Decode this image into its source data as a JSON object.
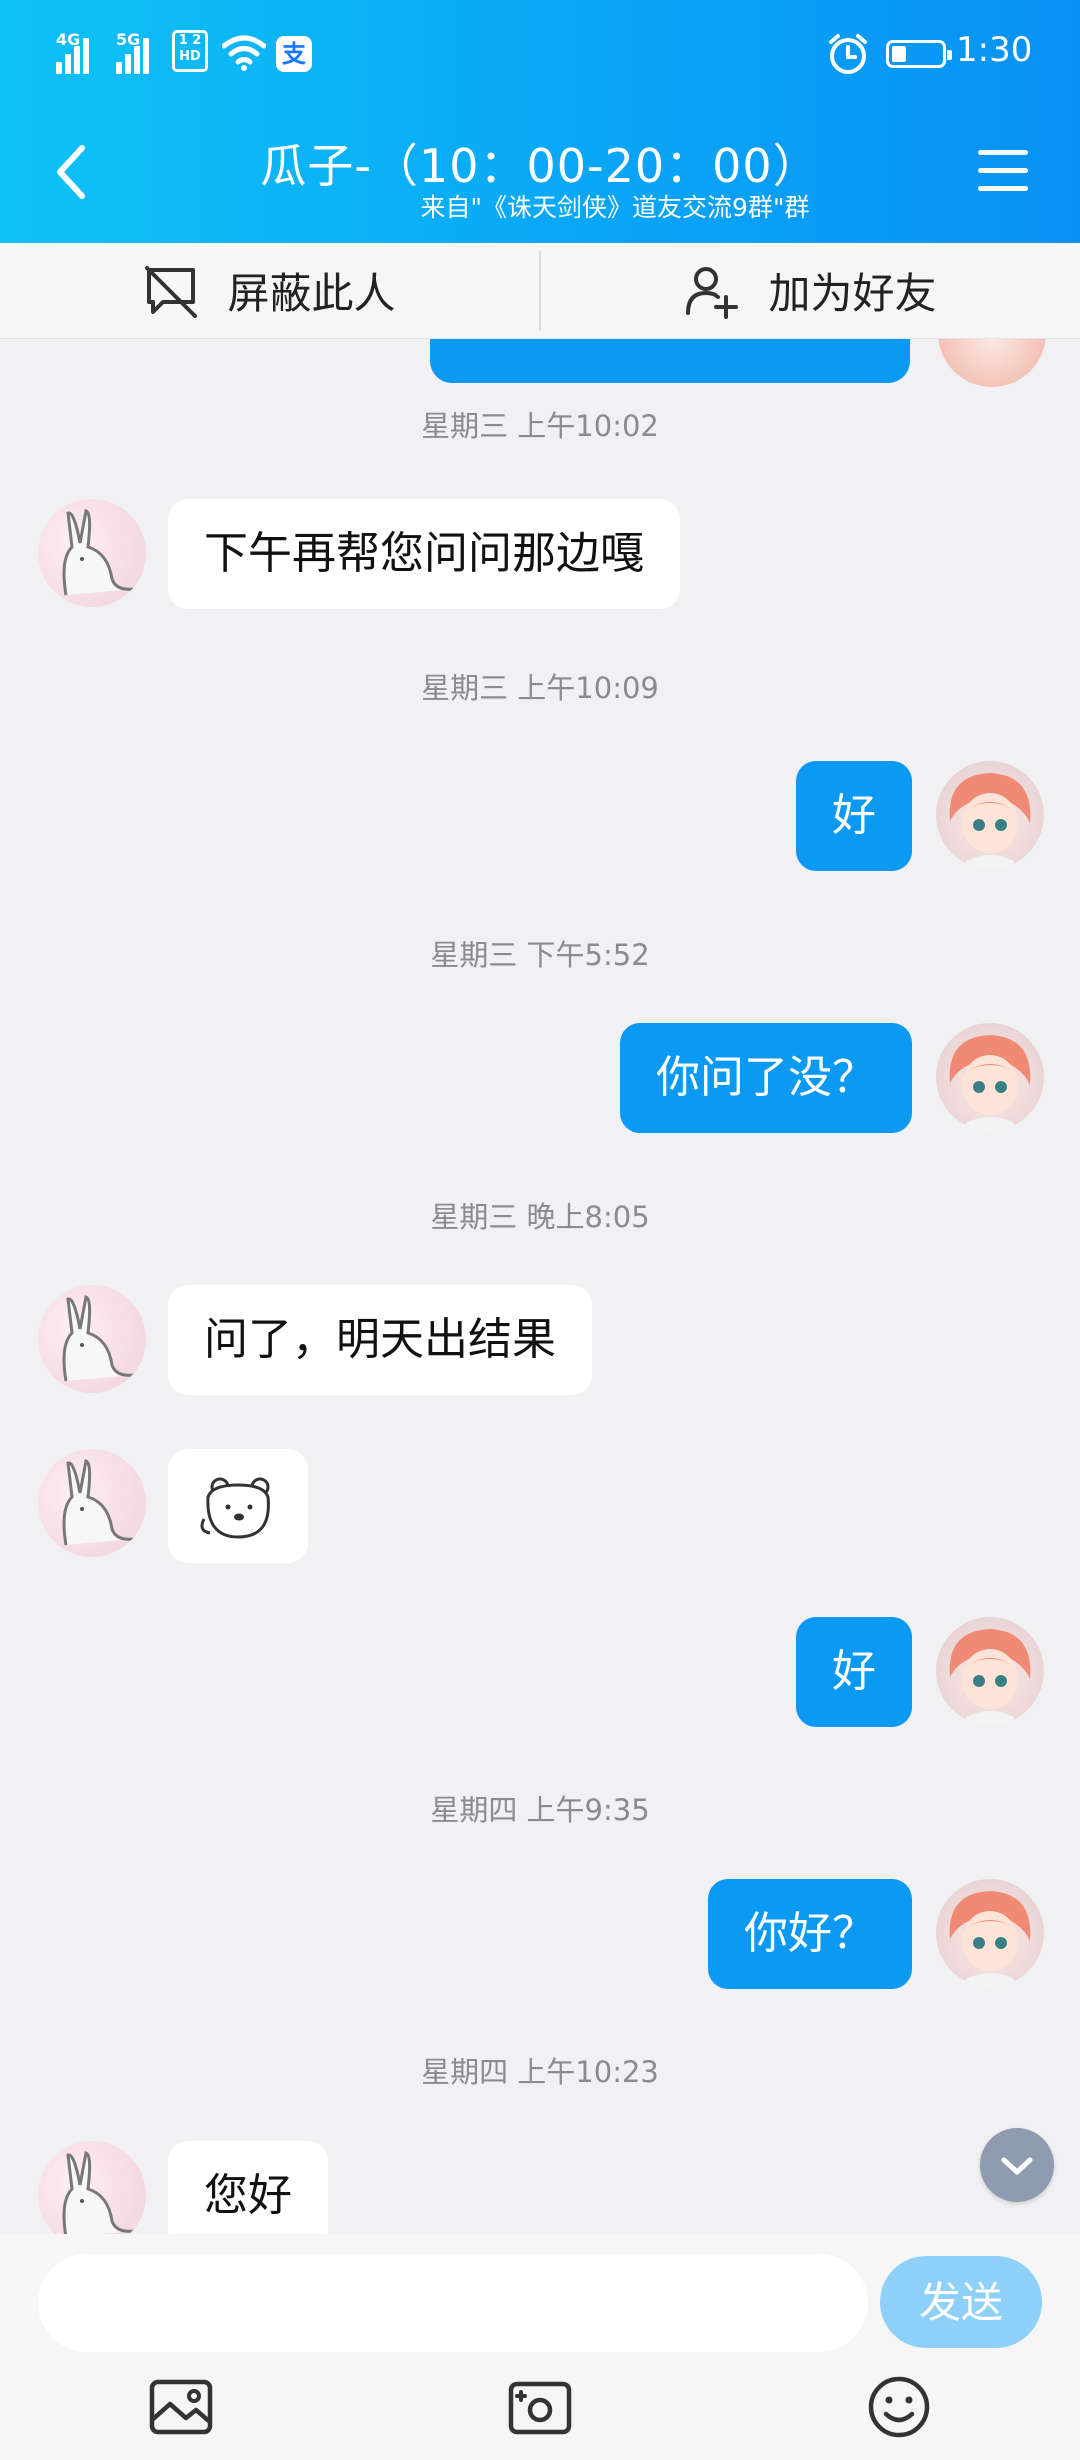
{
  "status_bar": {
    "network_1": "4G",
    "network_2": "5G",
    "hd_badge_top": "1 2",
    "hd_badge_bottom": "HD",
    "alipay_glyph": "支",
    "time": "1:30",
    "icons": [
      "signal-icon",
      "signal-icon",
      "hd-icon",
      "wifi-icon",
      "alipay-icon",
      "alarm-icon",
      "battery-icon"
    ]
  },
  "header": {
    "title": "瓜子-（10：00-20：00）",
    "subtitle": "来自\"《诛天剑侠》道友交流9群\"群",
    "background_start": "#0fc2f6",
    "background_end": "#0891f5"
  },
  "actions": {
    "block_label": "屏蔽此人",
    "add_friend_label": "加为好友"
  },
  "messages": [
    {
      "timestamp": "星期三 上午10:02",
      "side": "in",
      "type": "text",
      "text": "下午再帮您问问那边嘎"
    },
    {
      "timestamp": "星期三 上午10:09",
      "side": "out",
      "type": "text",
      "text": "好"
    },
    {
      "timestamp": "星期三 下午5:52",
      "side": "out",
      "type": "text",
      "text": "你问了没？"
    },
    {
      "timestamp": "星期三 晚上8:05",
      "side": "in",
      "type": "text",
      "text": "问了，明天出结果"
    },
    {
      "timestamp": "",
      "side": "in",
      "type": "sticker",
      "sticker": "bear-sticker-icon"
    },
    {
      "timestamp": "",
      "side": "out",
      "type": "text",
      "text": "好"
    },
    {
      "timestamp": "星期四 上午9:35",
      "side": "out",
      "type": "text",
      "text": "你好？"
    },
    {
      "timestamp": "星期四 上午10:23",
      "side": "in",
      "type": "text",
      "text": "您好"
    }
  ],
  "input": {
    "placeholder": "",
    "send_label": "发送"
  },
  "toolbar": [
    "image-icon",
    "camera-icon",
    "emoji-icon"
  ],
  "colors": {
    "outgoing_bubble": "#0b99f4",
    "incoming_bubble": "#ffffff",
    "chat_background": "#f1f1f3",
    "send_button": "#8fd0f8"
  }
}
